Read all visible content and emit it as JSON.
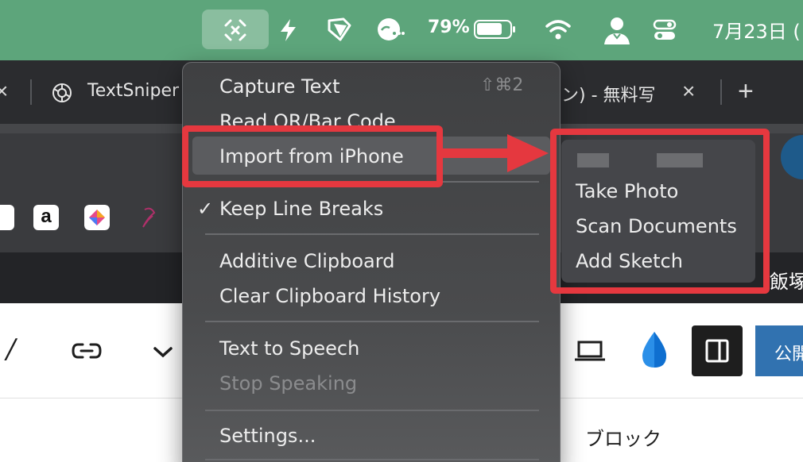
{
  "menubar": {
    "battery_percent": "79%",
    "date": "7月23日 (",
    "icons": [
      "textsniper-capture-icon",
      "bolt-icon",
      "tag-icon",
      "cloud-icon",
      "battery-icon",
      "wifi-icon",
      "user-icon",
      "control-center-icon"
    ]
  },
  "browser": {
    "tabs": [
      {
        "title": "TextSniper"
      },
      {
        "title": "ン) - 無料写"
      }
    ],
    "dark_strip_text": "飯塚",
    "bookmarks": [
      "bookmark-icon",
      "amazon-icon",
      "app-icon",
      "heart-icon"
    ]
  },
  "editor": {
    "publish_label": "公開",
    "block_label": "ブロック",
    "italic_label": "/"
  },
  "menu": {
    "capture_text": "Capture Text",
    "capture_shortcut": "⇧⌘2",
    "read_code": "Read QR/Bar Code",
    "import_iphone": "Import from iPhone",
    "keep_line_breaks": "Keep Line Breaks",
    "check": "✓",
    "additive_clipboard": "Additive Clipboard",
    "clear_history": "Clear Clipboard History",
    "text_to_speech": "Text to Speech",
    "stop_speaking": "Stop Speaking",
    "settings": "Settings..."
  },
  "submenu": {
    "take_photo": "Take Photo",
    "scan_documents": "Scan Documents",
    "add_sketch": "Add Sketch"
  },
  "colors": {
    "menubar": "#5da57b",
    "annotation_red": "#e5383f",
    "publish_blue": "#3172b0"
  }
}
